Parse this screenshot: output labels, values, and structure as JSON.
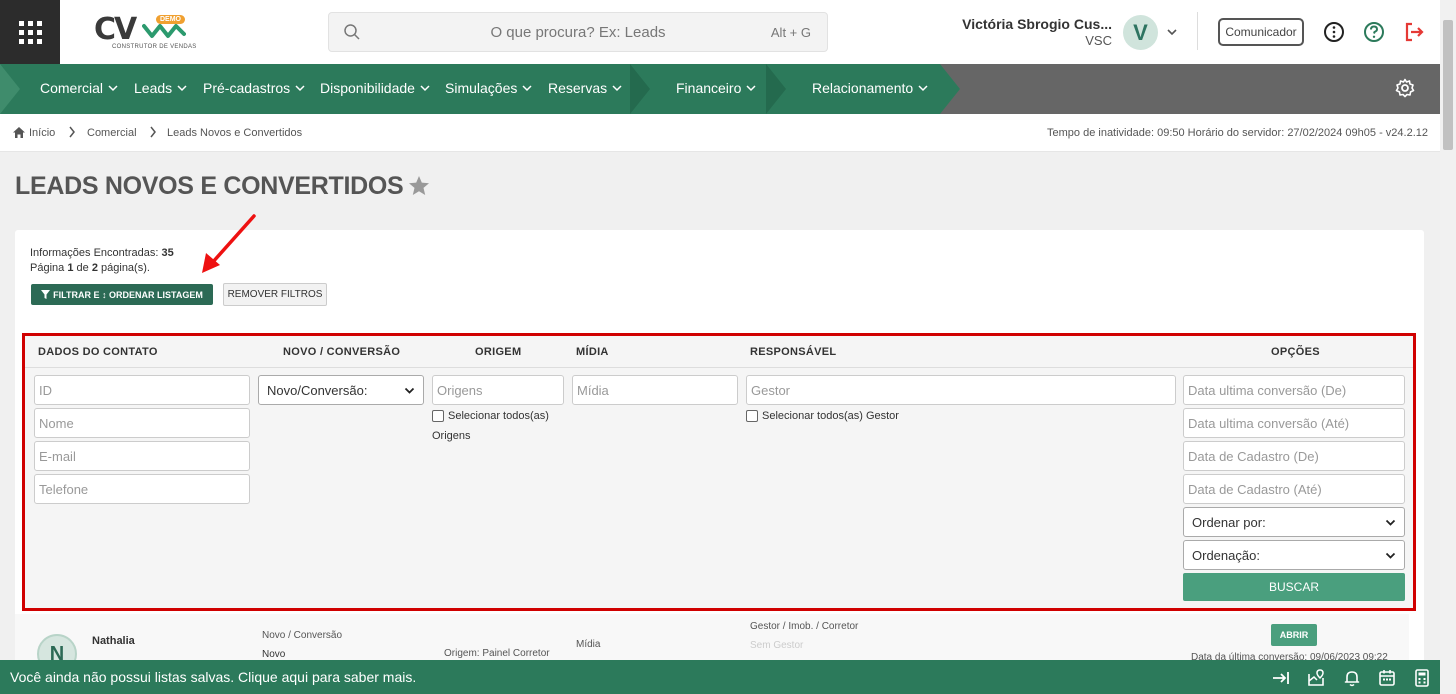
{
  "logo": {
    "letters": "CV",
    "badge": "DEMO",
    "tagline": "CONSTRUTOR DE VENDAS"
  },
  "search": {
    "placeholder": "O que procura? Ex: Leads",
    "shortcut": "Alt + G"
  },
  "user": {
    "name": "Victória Sbrogio Cus...",
    "org": "VSC",
    "initial": "V"
  },
  "header": {
    "comunicador": "Comunicador"
  },
  "nav": {
    "items": [
      "Comercial",
      "Leads",
      "Pré-cadastros",
      "Disponibilidade",
      "Simulações",
      "Reservas",
      "Financeiro",
      "Relacionamento"
    ]
  },
  "breadcrumb": {
    "home": "Início",
    "level1": "Comercial",
    "level2": "Leads Novos e Convertidos"
  },
  "server_info": "Tempo de inatividade: 09:50   Horário do servidor: 27/02/2024 09h05 - v24.2.12",
  "page": {
    "title": "LEADS NOVOS E CONVERTIDOS"
  },
  "results": {
    "found_label": "Informações Encontradas:",
    "found_count": "35",
    "page_prefix": "Página",
    "page_current": "1",
    "page_of": "de",
    "page_total": "2",
    "page_suffix": "página(s)."
  },
  "buttons": {
    "filter": "FILTRAR E ↕ ORDENAR LISTAGEM",
    "remove": "REMOVER FILTROS",
    "buscar": "BUSCAR",
    "abrir": "ABRIR"
  },
  "filters": {
    "headers": {
      "contato": "DADOS DO CONTATO",
      "novo": "NOVO / CONVERSÃO",
      "origem": "ORIGEM",
      "midia": "MÍDIA",
      "responsavel": "RESPONSÁVEL",
      "opcoes": "OPÇÕES"
    },
    "id_ph": "ID",
    "nome_ph": "Nome",
    "email_ph": "E-mail",
    "telefone_ph": "Telefone",
    "novo_select": "Novo/Conversão:",
    "origens_ph": "Origens",
    "origens_check": "Selecionar todos(as)",
    "origens_check2": "Origens",
    "midia_ph": "Mídia",
    "gestor_ph": "Gestor",
    "gestor_check": "Selecionar todos(as) Gestor",
    "conv_de_ph": "Data ultima conversão (De)",
    "conv_ate_ph": "Data ultima conversão (Até)",
    "cad_de_ph": "Data de Cadastro (De)",
    "cad_ate_ph": "Data de Cadastro (Até)",
    "ordenar_por": "Ordenar por:",
    "ordenacao": "Ordenação:"
  },
  "record": {
    "initial": "N",
    "name": "Nathalia",
    "novo_label": "Novo / Conversão",
    "novo_value": "Novo",
    "origem": "Origem: Painel Corretor",
    "midia": "Mídia",
    "resp_label": "Gestor / Imob. / Corretor",
    "resp_value": "Sem Gestor",
    "conv_date": "Data da última conversão: 09/06/2023 09:22"
  },
  "footer": {
    "message": "Você ainda não possui listas salvas. Clique aqui para saber mais."
  },
  "colors": {
    "primary": "#2c7a5b",
    "dark": "#2c2c2c",
    "nav_gray": "#666666",
    "highlight": "#d00000",
    "logout": "#e53935"
  },
  "icons": [
    "apps-grid-icon",
    "search-icon",
    "chevron-down-icon",
    "info-icon",
    "help-icon",
    "logout-icon",
    "gear-icon",
    "home-icon",
    "star-icon",
    "filter-icon",
    "arrow-annotation",
    "collapse-right-icon",
    "map-pin-icon",
    "bell-icon",
    "calendar-icon",
    "calculator-icon"
  ]
}
